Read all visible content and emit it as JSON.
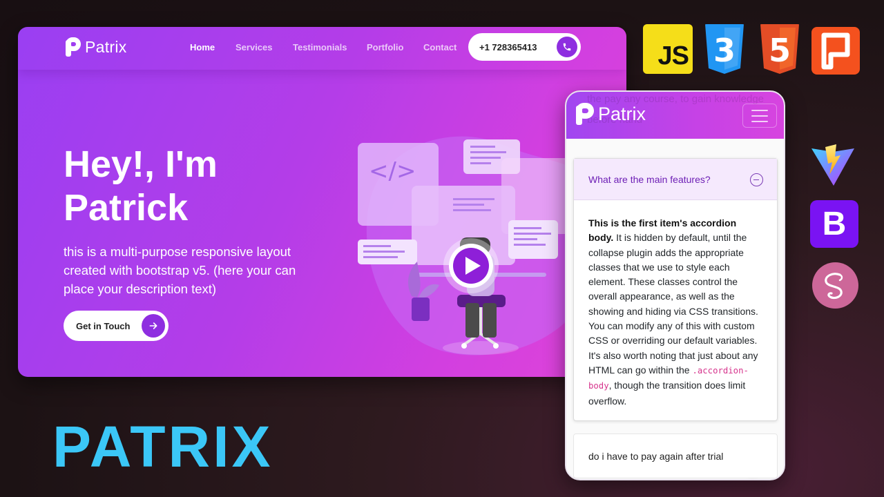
{
  "desktop": {
    "logo_text": "Patrix",
    "nav": {
      "home": "Home",
      "services": "Services",
      "testimonials": "Testimonials",
      "portfolio": "Portfolio",
      "contact": "Contact"
    },
    "phone": "+1 728365413",
    "hero": {
      "title_line1": "Hey!, I'm",
      "title_line2": "Patrick",
      "description": "this is a multi-purpose responsive layout created with bootstrap v5. (here your can place your description text)",
      "cta_label": "Get in Touch"
    }
  },
  "mobile": {
    "logo_text": "Patrix",
    "ghost_text": "the pay any course, to gain knowledge before hand",
    "accordion": [
      {
        "question": "What are the main features?",
        "body_strong": "This is the first item's accordion body.",
        "body_text": " It is hidden by default, until the collapse plugin adds the appropriate classes that we use to style each element. These classes control the overall appearance, as well as the showing and hiding via CSS transitions. You can modify any of this with custom CSS or overriding our default variables. It's also worth noting that just about any HTML can go within the ",
        "body_code": ".accordion-body",
        "body_tail": ", though the transition does limit overflow."
      },
      {
        "question": "do i have to pay again after trial"
      }
    ]
  },
  "brand_title": "PATRIX",
  "tech_icons": {
    "js": "JS",
    "css3": "3",
    "html5": "5",
    "bootstrap": "B"
  },
  "colors": {
    "brand_purple": "#8e2ee0",
    "title_cyan": "#3bc7f7"
  }
}
